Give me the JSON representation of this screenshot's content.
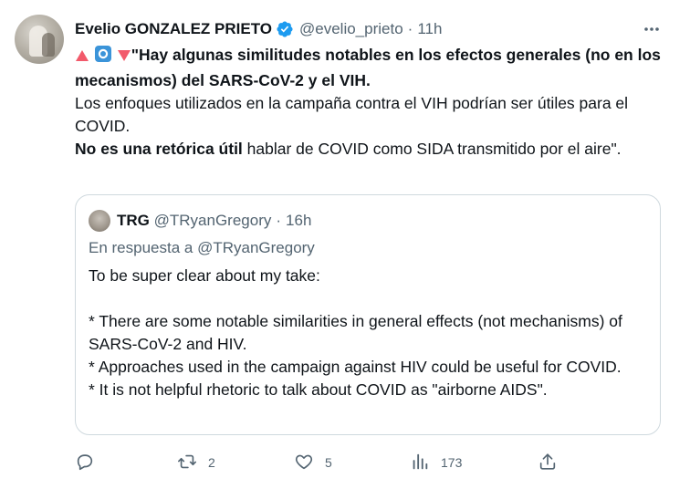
{
  "author": {
    "name": "Evelio GONZALEZ PRIETO",
    "handle": "@evelio_prieto",
    "separator": "·",
    "time": "11h"
  },
  "tweet": {
    "line1_bold": "\"Hay algunas similitudes notables en los efectos generales (no en los mecanismos) del SARS-CoV-2 y el VIH.",
    "para2": "Los enfoques utilizados en la campaña contra el VIH podrían ser útiles para el COVID.",
    "para3_bold": "No es una retórica útil",
    "para3_rest": " hablar de COVID como SIDA transmitido por el aire\"."
  },
  "quoted": {
    "name": "TRG",
    "handle": "@TRyanGregory",
    "separator": "·",
    "time": "16h",
    "reply_to": "En respuesta a @TRyanGregory",
    "lines": [
      "To be super clear about my take:",
      "* There are some notable similarities in general effects (not mechanisms) of SARS-CoV-2 and HIV.",
      "* Approaches used in the campaign against HIV could be useful for COVID.",
      "* It is not helpful rhetoric to talk about COVID as \"airborne AIDS\"."
    ]
  },
  "actions": {
    "reply_count": "",
    "retweet_count": "2",
    "like_count": "5",
    "views_count": "173"
  },
  "icons": {
    "verified": "verified-badge-icon",
    "more": "more-dots-icon",
    "reply": "reply-bubble-icon",
    "retweet": "retweet-icon",
    "like": "heart-icon",
    "views": "bar-chart-icon",
    "share": "share-upload-icon",
    "emoji_up": "red-triangle-up-emoji",
    "emoji_circle": "blue-circle-emoji",
    "emoji_down": "red-triangle-down-emoji"
  },
  "colors": {
    "verified": "#1d9bf0",
    "text": "#0f1419",
    "secondary": "#536471",
    "border": "#cfd9de"
  }
}
